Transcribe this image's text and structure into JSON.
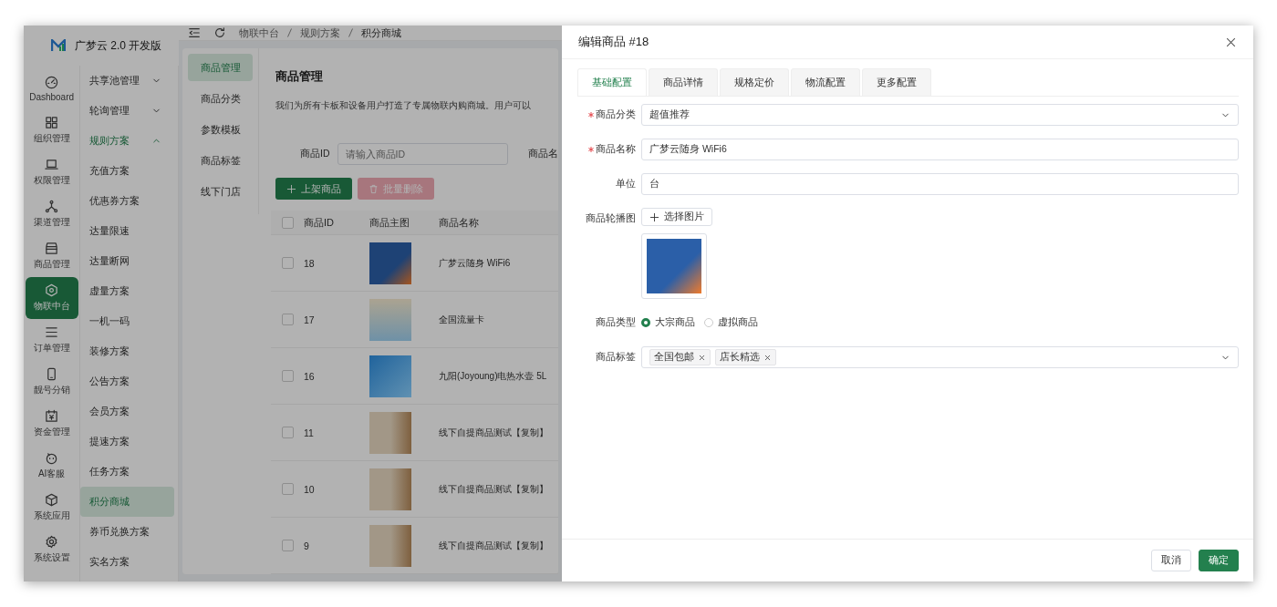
{
  "app": {
    "logo_text": "广梦云 2.0 开发版"
  },
  "rail": [
    {
      "label": "Dashboard",
      "selected": false
    },
    {
      "label": "组织管理",
      "selected": false
    },
    {
      "label": "权限管理",
      "selected": false
    },
    {
      "label": "渠道管理",
      "selected": false
    },
    {
      "label": "商品管理",
      "selected": false
    },
    {
      "label": "物联中台",
      "selected": true
    },
    {
      "label": "订单管理",
      "selected": false
    },
    {
      "label": "靓号分销",
      "selected": false
    },
    {
      "label": "资金管理",
      "selected": false
    },
    {
      "label": "AI客服",
      "selected": false
    },
    {
      "label": "系统应用",
      "selected": false
    },
    {
      "label": "系统设置",
      "selected": false
    }
  ],
  "sidebar": {
    "items": [
      {
        "label": "共享池管理",
        "expanded": false
      },
      {
        "label": "轮询管理",
        "expanded": false
      },
      {
        "label": "规则方案",
        "expanded": true,
        "children": [
          {
            "label": "充值方案",
            "selected": false
          },
          {
            "label": "优惠券方案",
            "selected": false
          },
          {
            "label": "达量限速",
            "selected": false
          },
          {
            "label": "达量断网",
            "selected": false
          },
          {
            "label": "虚量方案",
            "selected": false
          },
          {
            "label": "一机一码",
            "selected": false
          },
          {
            "label": "装修方案",
            "selected": false
          },
          {
            "label": "公告方案",
            "selected": false
          },
          {
            "label": "会员方案",
            "selected": false
          },
          {
            "label": "提速方案",
            "selected": false
          },
          {
            "label": "任务方案",
            "selected": false
          },
          {
            "label": "积分商城",
            "selected": true
          },
          {
            "label": "券币兑换方案",
            "selected": false
          },
          {
            "label": "实名方案",
            "selected": false
          }
        ]
      }
    ]
  },
  "toolbar": {
    "breadcrumb": [
      "物联中台",
      "规则方案",
      "积分商城"
    ]
  },
  "subnav": [
    {
      "label": "商品管理",
      "selected": true
    },
    {
      "label": "商品分类",
      "selected": false
    },
    {
      "label": "参数模板",
      "selected": false
    },
    {
      "label": "商品标签",
      "selected": false
    },
    {
      "label": "线下门店",
      "selected": false
    }
  ],
  "page": {
    "title": "商品管理",
    "description": "我们为所有卡板和设备用户打造了专属物联内购商城。用户可以",
    "filters": [
      {
        "label": "商品ID",
        "placeholder": "请输入商品ID"
      },
      {
        "label": "商品名"
      }
    ],
    "actions": [
      {
        "label": "上架商品",
        "kind": "primary",
        "disabled": false
      },
      {
        "label": "批量删除",
        "kind": "danger",
        "disabled": true
      }
    ],
    "table": {
      "all_checked": false,
      "columns": [
        "商品ID",
        "商品主图",
        "商品名称"
      ],
      "rows": [
        {
          "id": "18",
          "name": "广梦云随身 WiFi6",
          "checked": false
        },
        {
          "id": "17",
          "name": "全国流量卡",
          "checked": false
        },
        {
          "id": "16",
          "name": "九阳(Joyoung)电热水壶 5L",
          "checked": false
        },
        {
          "id": "11",
          "name": "线下自提商品测试【复制】",
          "checked": false
        },
        {
          "id": "10",
          "name": "线下自提商品测试【复制】",
          "checked": false
        },
        {
          "id": "9",
          "name": "线下自提商品测试【复制】",
          "checked": false
        }
      ]
    }
  },
  "drawer": {
    "title": "编辑商品 #18",
    "tabs": [
      {
        "label": "基础配置",
        "selected": true
      },
      {
        "label": "商品详情",
        "selected": false
      },
      {
        "label": "规格定价",
        "selected": false
      },
      {
        "label": "物流配置",
        "selected": false
      },
      {
        "label": "更多配置",
        "selected": false
      }
    ],
    "fields": [
      {
        "kind": "select",
        "label": "商品分类",
        "required": true,
        "value": "超值推荐"
      },
      {
        "kind": "input",
        "label": "商品名称",
        "required": true,
        "value": "广梦云随身 WiFi6"
      },
      {
        "kind": "input",
        "label": "单位",
        "required": false,
        "value": "台"
      },
      {
        "kind": "images",
        "label": "商品轮播图",
        "required": false,
        "button": "选择图片"
      },
      {
        "kind": "radio",
        "label": "商品类型",
        "required": false,
        "options": [
          {
            "label": "大宗商品",
            "selected": true
          },
          {
            "label": "虚拟商品",
            "selected": false
          }
        ]
      },
      {
        "kind": "tags",
        "label": "商品标签",
        "required": false,
        "tags": [
          "全国包邮",
          "店长精选"
        ]
      }
    ],
    "buttons": [
      {
        "label": "取消",
        "kind": "default"
      },
      {
        "label": "确定",
        "kind": "primary"
      }
    ]
  }
}
